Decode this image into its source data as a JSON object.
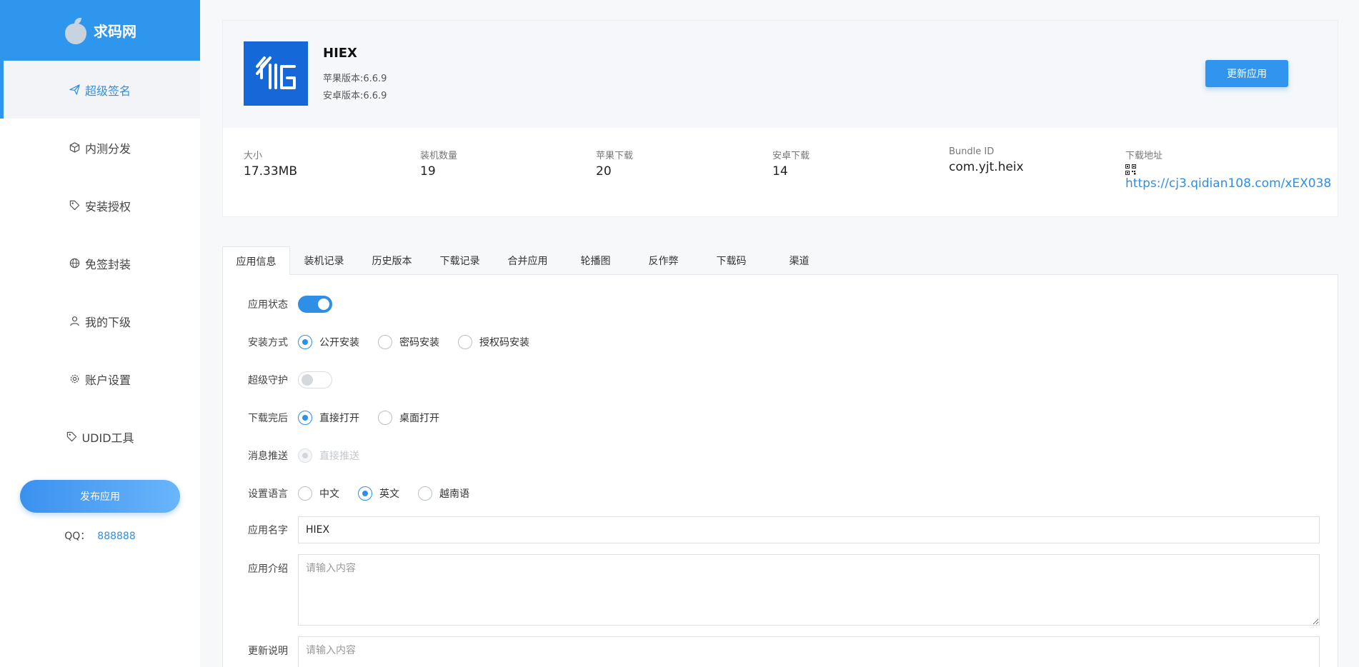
{
  "brand": {
    "name": "求码网"
  },
  "sidebar": {
    "items": [
      {
        "label": "超级签名",
        "icon": "send-icon",
        "active": true
      },
      {
        "label": "内测分发",
        "icon": "cube-icon"
      },
      {
        "label": "安装授权",
        "icon": "tag-icon"
      },
      {
        "label": "免签封装",
        "icon": "globe-icon"
      },
      {
        "label": "我的下级",
        "icon": "user-icon"
      },
      {
        "label": "账户设置",
        "icon": "gear-icon"
      },
      {
        "label": "UDID工具",
        "icon": "tag-icon"
      }
    ],
    "publish_label": "发布应用",
    "qq_label": "QQ：",
    "qq_number": "888888"
  },
  "app": {
    "name": "HIEX",
    "ios_version": "苹果版本:6.6.9",
    "android_version": "安卓版本:6.6.9",
    "update_label": "更新应用",
    "icon_color": "#1668d8"
  },
  "stats": {
    "size": {
      "label": "大小",
      "value": "17.33MB"
    },
    "installs": {
      "label": "装机数量",
      "value": "19"
    },
    "ios_downloads": {
      "label": "苹果下载",
      "value": "20"
    },
    "android_downloads": {
      "label": "安卓下载",
      "value": "14"
    },
    "bundle": {
      "label": "Bundle ID",
      "value": "com.yjt.heix"
    },
    "download_url": {
      "label": "下载地址",
      "value": "https://cj3.qidian108.com/xEX038"
    }
  },
  "tabs": [
    "应用信息",
    "装机记录",
    "历史版本",
    "下载记录",
    "合并应用",
    "轮播图",
    "反作弊",
    "下载码",
    "渠道"
  ],
  "form": {
    "status": {
      "label": "应用状态",
      "on": true
    },
    "install_mode": {
      "label": "安装方式",
      "options": [
        "公开安装",
        "密码安装",
        "授权码安装"
      ],
      "selected": "公开安装"
    },
    "super_guard": {
      "label": "超级守护",
      "on": false
    },
    "after_download": {
      "label": "下载完后",
      "options": [
        "直接打开",
        "桌面打开"
      ],
      "selected": "直接打开"
    },
    "push": {
      "label": "消息推送",
      "option": "直接推送"
    },
    "language": {
      "label": "设置语言",
      "options": [
        "中文",
        "英文",
        "越南语"
      ],
      "selected": "英文"
    },
    "app_name": {
      "label": "应用名字",
      "value": "HIEX"
    },
    "intro": {
      "label": "应用介绍",
      "placeholder": "请输入内容"
    },
    "changelog": {
      "label": "更新说明",
      "placeholder": "请输入内容"
    }
  },
  "colors": {
    "accent": "#2f8fe6",
    "brand_bg": "#2f96ee"
  }
}
